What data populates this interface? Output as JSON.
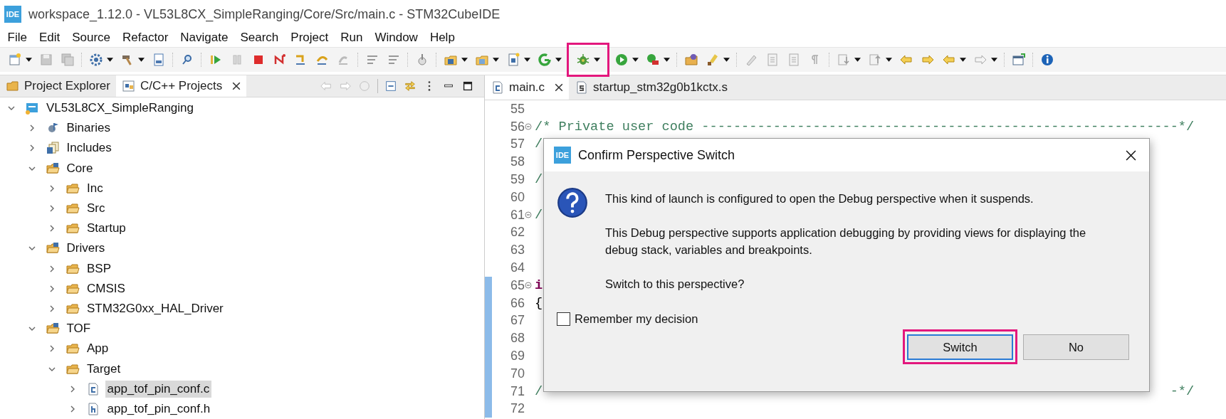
{
  "window": {
    "badge": "IDE",
    "title": "workspace_1.12.0 - VL53L8CX_SimpleRanging/Core/Src/main.c - STM32CubeIDE"
  },
  "menu": [
    "File",
    "Edit",
    "Source",
    "Refactor",
    "Navigate",
    "Search",
    "Project",
    "Run",
    "Window",
    "Help"
  ],
  "toolbar": [
    {
      "kind": "new",
      "dropdown": true,
      "highlighted": false
    },
    {
      "kind": "save",
      "dropdown": false,
      "highlighted": false
    },
    {
      "kind": "saveall",
      "dropdown": false,
      "highlighted": false
    },
    {
      "kind": "sep"
    },
    {
      "kind": "gear",
      "dropdown": true,
      "highlighted": false
    },
    {
      "kind": "hammer",
      "dropdown": true,
      "highlighted": false
    },
    {
      "kind": "binary",
      "dropdown": false,
      "highlighted": false
    },
    {
      "kind": "sep"
    },
    {
      "kind": "search",
      "dropdown": false,
      "highlighted": false
    },
    {
      "kind": "sep"
    },
    {
      "kind": "resume",
      "dropdown": false,
      "highlighted": false
    },
    {
      "kind": "pause",
      "dropdown": false,
      "highlighted": false
    },
    {
      "kind": "stop",
      "dropdown": false,
      "highlighted": false
    },
    {
      "kind": "disconnect",
      "dropdown": false,
      "highlighted": false
    },
    {
      "kind": "step_into",
      "dropdown": false,
      "highlighted": false
    },
    {
      "kind": "step_over",
      "dropdown": false,
      "highlighted": false
    },
    {
      "kind": "step_return",
      "dropdown": false,
      "highlighted": false
    },
    {
      "kind": "sep"
    },
    {
      "kind": "filter",
      "dropdown": false,
      "highlighted": false
    },
    {
      "kind": "filter",
      "dropdown": false,
      "highlighted": false
    },
    {
      "kind": "sep"
    },
    {
      "kind": "hand",
      "dropdown": false,
      "highlighted": false
    },
    {
      "kind": "sep"
    },
    {
      "kind": "new_project",
      "dropdown": true,
      "highlighted": false
    },
    {
      "kind": "new_folder",
      "dropdown": true,
      "highlighted": false
    },
    {
      "kind": "new_file",
      "dropdown": true,
      "highlighted": false
    },
    {
      "kind": "refresh",
      "dropdown": true,
      "highlighted": false
    },
    {
      "kind": "debug",
      "dropdown": true,
      "highlighted": true
    },
    {
      "kind": "run",
      "dropdown": true,
      "highlighted": false
    },
    {
      "kind": "ext_tools",
      "dropdown": true,
      "highlighted": false
    },
    {
      "kind": "sep"
    },
    {
      "kind": "open",
      "dropdown": false,
      "highlighted": false
    },
    {
      "kind": "brush",
      "dropdown": true,
      "highlighted": false
    },
    {
      "kind": "sep"
    },
    {
      "kind": "pencil",
      "dropdown": false,
      "highlighted": false
    },
    {
      "kind": "doc_check",
      "dropdown": false,
      "highlighted": false
    },
    {
      "kind": "doc",
      "dropdown": false,
      "highlighted": false
    },
    {
      "kind": "pilcrow",
      "dropdown": false,
      "highlighted": false
    },
    {
      "kind": "sep"
    },
    {
      "kind": "annot_down",
      "dropdown": true,
      "highlighted": false
    },
    {
      "kind": "annot_up",
      "dropdown": true,
      "highlighted": false
    },
    {
      "kind": "edit_back",
      "dropdown": false,
      "highlighted": false
    },
    {
      "kind": "edit_fwd",
      "dropdown": false,
      "highlighted": false
    },
    {
      "kind": "nav_back",
      "dropdown": true,
      "highlighted": false
    },
    {
      "kind": "nav_fwd",
      "dropdown": true,
      "highlighted": false
    },
    {
      "kind": "sep"
    },
    {
      "kind": "new_window",
      "dropdown": false,
      "highlighted": false
    },
    {
      "kind": "sep"
    },
    {
      "kind": "info",
      "dropdown": false,
      "highlighted": false
    }
  ],
  "left_panel": {
    "tabs": [
      {
        "label": "Project Explorer",
        "kind": "explorer",
        "selected": false,
        "closable": false
      },
      {
        "label": "C/C++ Projects",
        "kind": "projects",
        "selected": true,
        "closable": true
      }
    ],
    "tree": [
      {
        "label": "VL53L8CX_SimpleRanging",
        "kind": "project",
        "expanded": true,
        "selected": false,
        "children": [
          {
            "label": "Binaries",
            "kind": "binaries",
            "expanded": false,
            "selected": false
          },
          {
            "label": "Includes",
            "kind": "includes",
            "expanded": false,
            "selected": false
          },
          {
            "label": "Core",
            "kind": "source_folder",
            "expanded": true,
            "selected": false,
            "children": [
              {
                "label": "Inc",
                "kind": "folder",
                "expanded": false,
                "selected": false
              },
              {
                "label": "Src",
                "kind": "folder",
                "expanded": false,
                "selected": false
              },
              {
                "label": "Startup",
                "kind": "folder",
                "expanded": false,
                "selected": false
              }
            ]
          },
          {
            "label": "Drivers",
            "kind": "source_folder",
            "expanded": true,
            "selected": false,
            "children": [
              {
                "label": "BSP",
                "kind": "folder",
                "expanded": false,
                "selected": false
              },
              {
                "label": "CMSIS",
                "kind": "folder",
                "expanded": false,
                "selected": false
              },
              {
                "label": "STM32G0xx_HAL_Driver",
                "kind": "folder",
                "expanded": false,
                "selected": false
              }
            ]
          },
          {
            "label": "TOF",
            "kind": "source_folder",
            "expanded": true,
            "selected": false,
            "children": [
              {
                "label": "App",
                "kind": "folder",
                "expanded": false,
                "selected": false
              },
              {
                "label": "Target",
                "kind": "folder",
                "expanded": true,
                "selected": false,
                "children": [
                  {
                    "label": "app_tof_pin_conf.c",
                    "kind": "c_file",
                    "expanded": false,
                    "selected": true
                  },
                  {
                    "label": "app_tof_pin_conf.h",
                    "kind": "h_file",
                    "expanded": false,
                    "selected": false
                  }
                ]
              }
            ]
          }
        ]
      }
    ]
  },
  "editor": {
    "tabs": [
      {
        "label": "main.c",
        "kind": "c_file",
        "selected": true,
        "closable": true
      },
      {
        "label": "startup_stm32g0b1kctx.s",
        "kind": "s_file",
        "selected": false,
        "closable": false
      }
    ],
    "lines": [
      {
        "number": "55",
        "foldable": false,
        "changed": false
      },
      {
        "number": "56",
        "foldable": true,
        "changed": false,
        "kind": "comment",
        "text": "/* Private user code ------------------------------------------------------------*/"
      },
      {
        "number": "57",
        "foldable": false,
        "changed": false,
        "kind": "comment",
        "text": "/"
      },
      {
        "number": "58",
        "foldable": false,
        "changed": false
      },
      {
        "number": "59",
        "foldable": false,
        "changed": false,
        "kind": "comment",
        "text": "/"
      },
      {
        "number": "60",
        "foldable": false,
        "changed": false
      },
      {
        "number": "61",
        "foldable": true,
        "changed": false,
        "kind": "comment",
        "text": "/"
      },
      {
        "number": "62",
        "foldable": false,
        "changed": false
      },
      {
        "number": "63",
        "foldable": false,
        "changed": false
      },
      {
        "number": "64",
        "foldable": false,
        "changed": false
      },
      {
        "number": "65",
        "foldable": true,
        "changed": true,
        "kind": "keyword",
        "text": "i"
      },
      {
        "number": "66",
        "foldable": false,
        "changed": true,
        "kind": "plain",
        "text": "{"
      },
      {
        "number": "67",
        "foldable": false,
        "changed": true
      },
      {
        "number": "68",
        "foldable": false,
        "changed": true
      },
      {
        "number": "69",
        "foldable": false,
        "changed": true
      },
      {
        "number": "70",
        "foldable": false,
        "changed": true
      },
      {
        "number": "71",
        "foldable": false,
        "changed": true,
        "kind": "comment",
        "text": "/",
        "tail": "-*/"
      },
      {
        "number": "72",
        "foldable": false,
        "changed": true
      }
    ]
  },
  "dialog": {
    "badge": "IDE",
    "title": "Confirm Perspective Switch",
    "paragraphs": [
      "This kind of launch is configured to open the Debug perspective when it suspends.",
      "This Debug perspective supports application debugging by providing views for displaying the debug stack, variables and breakpoints.",
      "Switch to this perspective?"
    ],
    "checkbox": {
      "label": "Remember my decision",
      "checked": false
    },
    "buttons": [
      {
        "label": "Switch",
        "default": true,
        "highlighted": true
      },
      {
        "label": "No",
        "default": false,
        "highlighted": false
      }
    ]
  }
}
